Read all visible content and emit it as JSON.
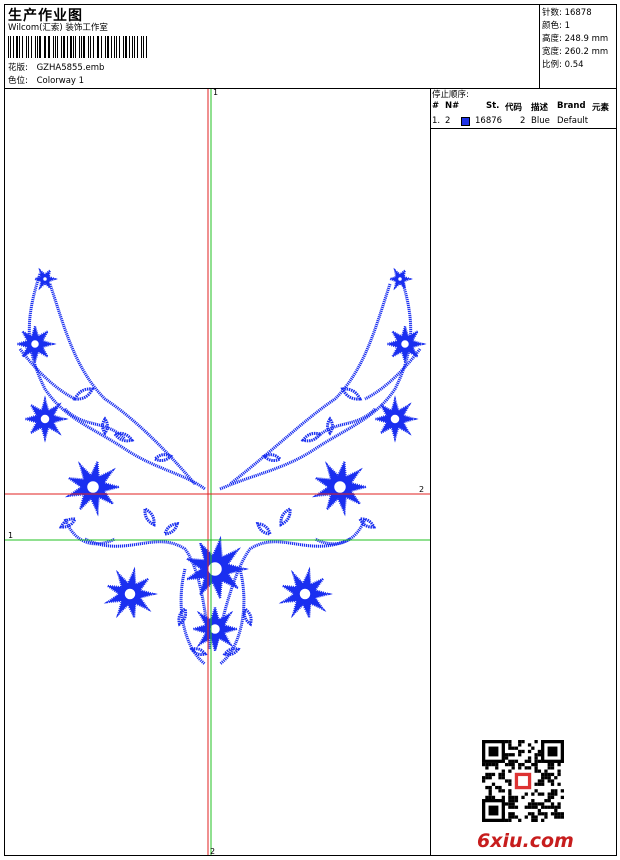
{
  "header": {
    "title": "生产作业图",
    "company": "Wilcom(汇索) 装饰工作室",
    "design_label": "花版:",
    "design_value": "GZHA5855.emb",
    "colorway_label": "色位:",
    "colorway_value": "Colorway 1"
  },
  "stats": [
    {
      "label": "针数:",
      "value": "16878"
    },
    {
      "label": "颜色:",
      "value": "1"
    },
    {
      "label": "高度:",
      "value": "248.9 mm"
    },
    {
      "label": "宽度:",
      "value": "260.2 mm"
    },
    {
      "label": "比例:",
      "value": "0.54"
    }
  ],
  "stop_sequence": {
    "title": "停止顺序:",
    "columns": [
      "#",
      "N#",
      "St.",
      "代码",
      "描述",
      "Brand",
      "元素"
    ],
    "rows": [
      {
        "index": "1.",
        "needle": "2",
        "stitches": "16876",
        "code": "2",
        "description": "Blue",
        "brand": "Default",
        "swatch_color": "#1f33e6"
      }
    ]
  },
  "guides": {
    "v_green_top": "1",
    "v_red_bottom": "2",
    "h_green_left": "1",
    "h_red_right": "2"
  },
  "watermark": "6xiu.com",
  "design_color": "#1a2ff0"
}
